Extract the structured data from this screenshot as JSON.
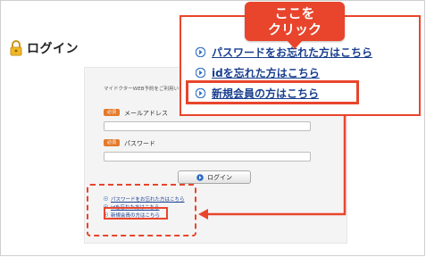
{
  "header": {
    "title": "ログイン",
    "icon": "lock-icon"
  },
  "form": {
    "intro": "マイドクターWEB予約をご利用いただ",
    "required_badge": "必須",
    "email_label": "メールアドレス",
    "email_value": "",
    "password_label": "パスワード",
    "password_value": "",
    "login_button": "ログイン"
  },
  "links": [
    {
      "label": "パスワードをお忘れた方はこちら"
    },
    {
      "label": "idを忘れた方はこちら"
    },
    {
      "label": "新規会員の方はこちら"
    }
  ],
  "callout": {
    "badge_line1": "ここを",
    "badge_line2": "クリック",
    "links": [
      {
        "label": "パスワードをお忘れた方はこちら"
      },
      {
        "label": "idを忘れた方はこちら"
      },
      {
        "label": "新規会員の方はこちら"
      }
    ]
  },
  "colors": {
    "accent": "#e8452c",
    "link": "#1a3f8f",
    "badge_orange": "#e57a2a"
  }
}
